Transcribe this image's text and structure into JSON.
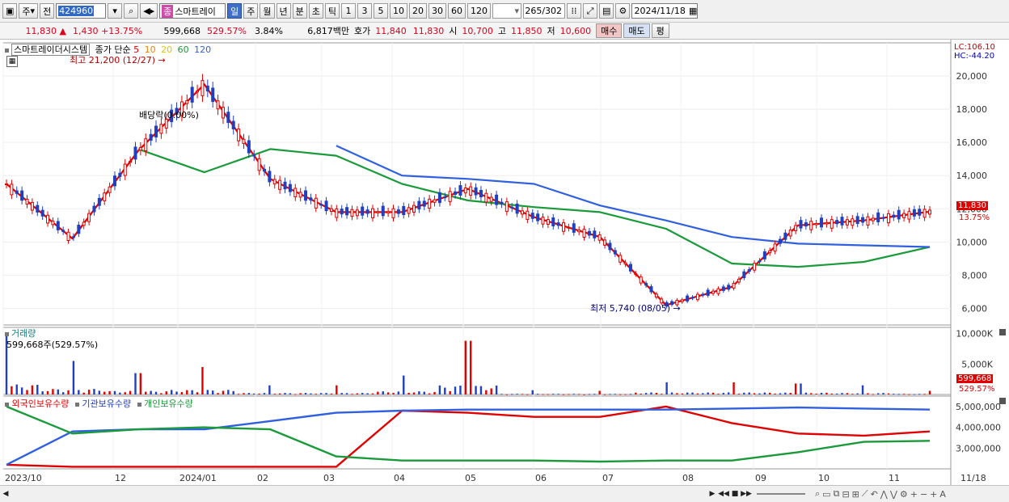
{
  "toolbar": {
    "period_sel": "주",
    "prev": "전",
    "code": "424960",
    "badge": "종",
    "name": "스마트레이",
    "tf": [
      "일",
      "주",
      "월",
      "년",
      "분",
      "초",
      "틱"
    ],
    "tf_selected": "일",
    "nums": [
      "1",
      "3",
      "5",
      "10",
      "20",
      "30",
      "60",
      "120"
    ],
    "count": "265",
    "total": "/302",
    "date": "2024/11/18"
  },
  "quote": {
    "price": "11,830",
    "change": "1,430",
    "change_pct": "+13.75%",
    "volume": "599,668",
    "vol_ratio": "529.57%",
    "turnover": "3.84%",
    "amount": "6,817백만",
    "ask_label": "호가",
    "ask": "11,840",
    "bid": "11,830",
    "open_label": "시",
    "open": "10,700",
    "high_label": "고",
    "high": "11,850",
    "low_label": "저",
    "low": "10,600",
    "buy": "매수",
    "sell": "매도",
    "flat": "평"
  },
  "price_panel": {
    "name": "스마트레이더시스템",
    "ma_label": "종가 단순",
    "ma_periods": [
      "5",
      "10",
      "20",
      "60",
      "120"
    ],
    "high_note": "최고 21,200 (12/27)",
    "low_note": "최저 5,740 (08/05)",
    "dividend_note": "배당락(0.00%)",
    "lc": "LC:106.10",
    "hc": "HC:-44.20",
    "price_tag": "11,830",
    "pct_tag": "13.75%",
    "yticks": [
      "20,000",
      "18,000",
      "16,000",
      "14,000",
      "12,000",
      "10,000",
      "8,000",
      "6,000"
    ]
  },
  "volume_panel": {
    "title": "거래량",
    "value": "599,668주(529.57%)",
    "yticks": [
      "10,000K",
      "5,000K"
    ],
    "vol_tag": "599,668",
    "pct_tag": "529.57%"
  },
  "holding_panel": {
    "legend": [
      "외국인보유수량",
      "기관보유수량",
      "개인보유수량"
    ],
    "yticks": [
      "5,000,000",
      "4,000,000",
      "3,000,000"
    ]
  },
  "x_axis": [
    "2023/10",
    "12",
    "2024/01",
    "02",
    "03",
    "04",
    "05",
    "06",
    "07",
    "08",
    "09",
    "10",
    "11",
    "11/18"
  ],
  "colors": {
    "ma5": "#e00000",
    "ma10": "#f08000",
    "ma20": "#f5e000",
    "ma60": "#1a9a3a",
    "ma120": "#3060e0",
    "up": "#e00000",
    "down": "#2040c0"
  },
  "chart_data": [
    {
      "type": "line",
      "title": "스마트레이더시스템",
      "y_unit": "KRW",
      "ylim": [
        5000,
        22000
      ],
      "x": [
        "2023/10",
        "2023/11",
        "2023/12",
        "2024/01",
        "2024/02",
        "2024/03",
        "2024/04",
        "2024/05",
        "2024/06",
        "2024/07",
        "2024/08",
        "2024/09",
        "2024/10",
        "2024/11",
        "11/18"
      ],
      "series": [
        {
          "name": "종가",
          "values": [
            13500,
            10200,
            15500,
            19500,
            13800,
            11800,
            11800,
            13200,
            11500,
            10300,
            6200,
            7300,
            11000,
            11300,
            11830
          ]
        },
        {
          "name": "60",
          "values": [
            null,
            null,
            15600,
            14200,
            15600,
            15200,
            13500,
            12500,
            12100,
            11800,
            10800,
            8700,
            8500,
            8800,
            9700
          ]
        },
        {
          "name": "120",
          "values": [
            null,
            null,
            null,
            null,
            null,
            15800,
            14000,
            13800,
            13500,
            12200,
            11300,
            10300,
            9900,
            9800,
            9700
          ]
        }
      ]
    },
    {
      "type": "bar",
      "title": "거래량",
      "ylim": [
        0,
        11000000
      ],
      "series": [
        {
          "name": "거래량",
          "values": [
            9800000,
            5500000,
            3500000,
            4500000,
            1500000,
            1500000,
            3100000,
            8800000,
            700000,
            600000,
            2000000,
            2000000,
            1800000,
            1500000,
            599668
          ]
        }
      ]
    },
    {
      "type": "line",
      "title": "보유수량",
      "ylim": [
        2000000,
        5500000
      ],
      "series": [
        {
          "name": "외국인보유수량",
          "values": [
            2200000,
            2100000,
            2100000,
            2100000,
            2100000,
            2100000,
            4800000,
            4700000,
            4500000,
            4500000,
            5000000,
            4200000,
            3700000,
            3600000,
            3800000
          ]
        },
        {
          "name": "기관보유수량",
          "values": [
            2200000,
            3800000,
            3900000,
            3900000,
            4300000,
            4700000,
            4800000,
            4850000,
            4850000,
            4850000,
            4850000,
            4900000,
            4950000,
            4900000,
            4850000
          ]
        },
        {
          "name": "개인보유수량",
          "values": [
            5000000,
            3700000,
            3900000,
            4000000,
            3900000,
            2600000,
            2400000,
            2400000,
            2400000,
            2350000,
            2400000,
            2400000,
            2800000,
            3300000,
            3350000
          ]
        }
      ]
    }
  ]
}
